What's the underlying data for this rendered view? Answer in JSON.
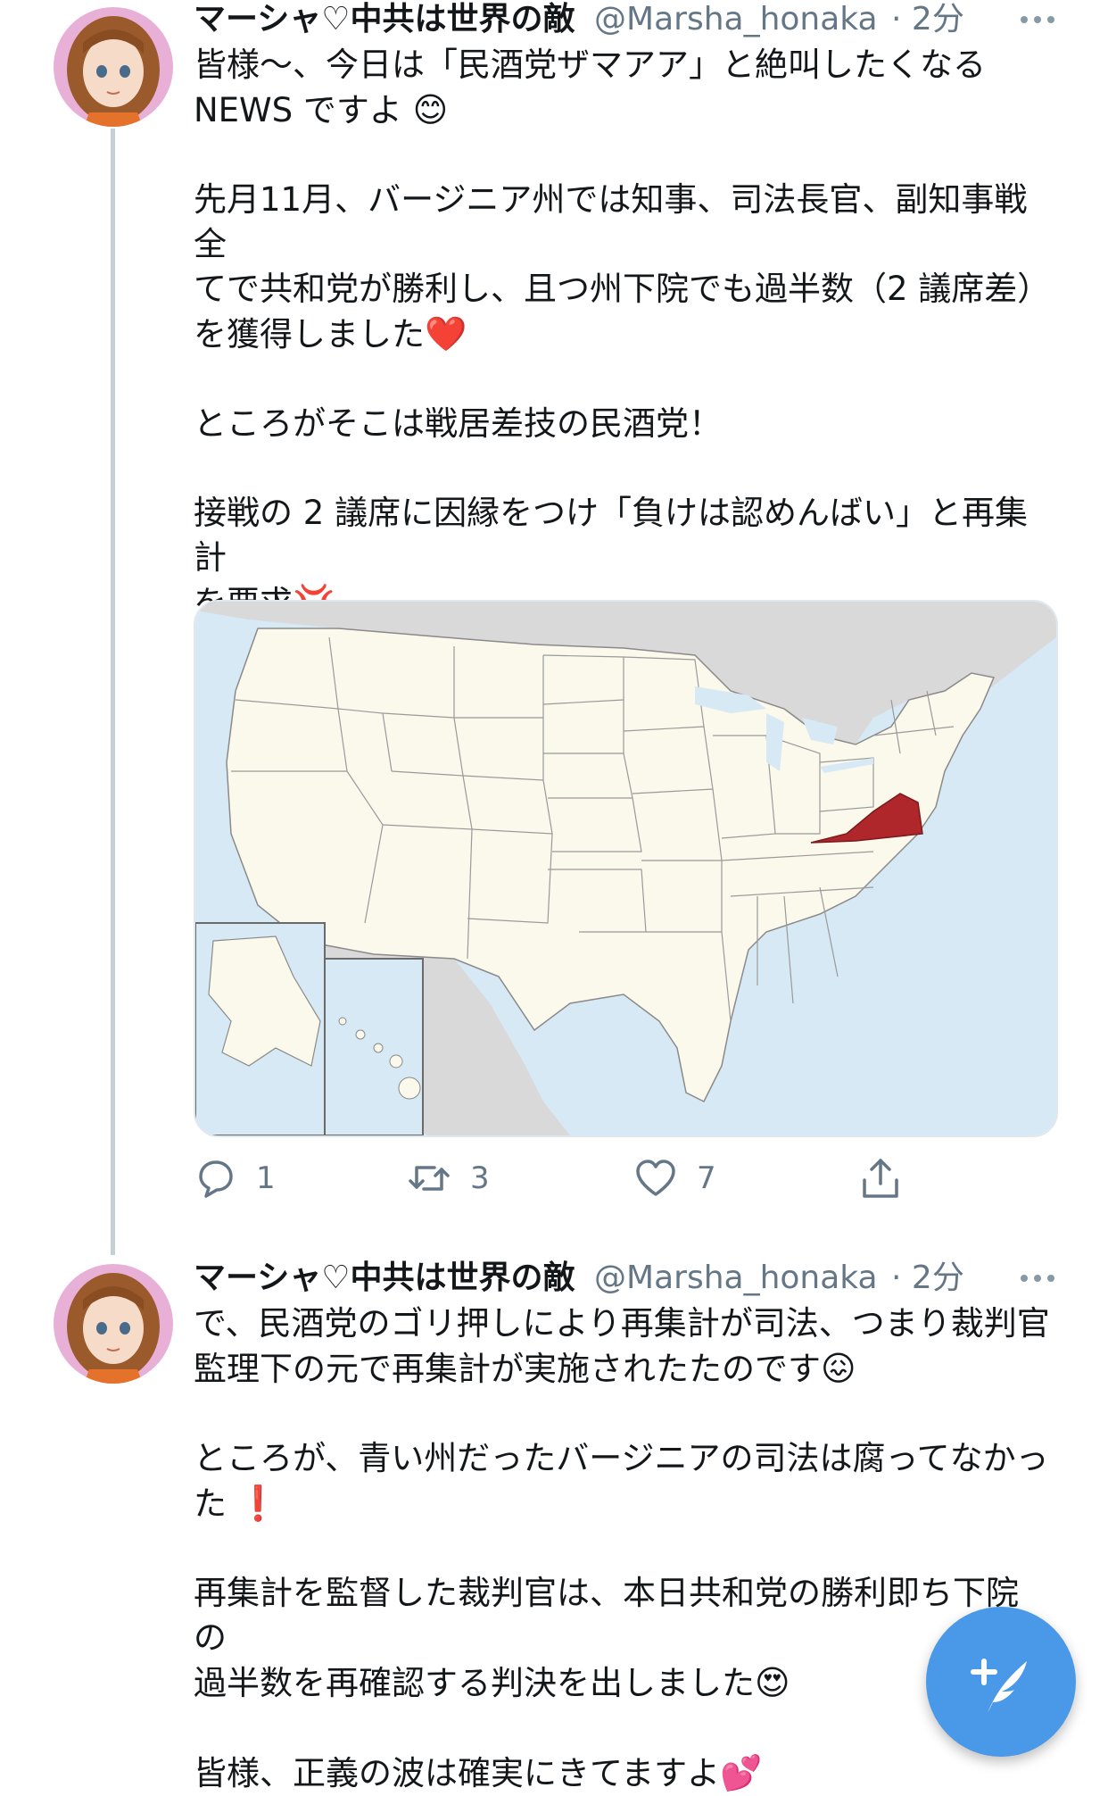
{
  "tweets": [
    {
      "name": "マーシャ♡中共は世界の敵",
      "handle": "@Marsha_honaka",
      "time": "· 2分",
      "lines": [
        "皆様〜、今日は「民酒党ザマアア」と絶叫したくなる",
        "NEWS ですよ"
      ],
      "emoji_1": "😊",
      "para2": [
        "先月11月、バージニア州では知事、司法長官、副知事戦全",
        "てで共和党が勝利し、且つ州下院でも過半数（2 議席差）",
        "を獲得しました"
      ],
      "emoji_2": "❤️",
      "para3": "ところがそこは戦居差技の民酒党！",
      "para4": [
        "接戦の 2 議席に因縁をつけ「負けは認めんばい」と再集計",
        "を要求"
      ],
      "emoji_4": "💢",
      "arrow": "↓",
      "stats": {
        "replies": "1",
        "retweets": "3",
        "likes": "7"
      }
    },
    {
      "name": "マーシャ♡中共は世界の敵",
      "handle": "@Marsha_honaka",
      "time": "· 2分",
      "para1": [
        "で、民酒党のゴリ押しにより再集計が司法、つまり裁判官",
        "監理下の元で再集計が実施されたたのです"
      ],
      "emoji_1": "😖",
      "para2": [
        "ところが、青い州だったバージニアの司法は腐ってなかっ",
        "た"
      ],
      "emoji_2": "❗",
      "para3": [
        "再集計を監督した裁判官は、本日共和党の勝利即ち下院の",
        "過半数を再確認する判決を出しました"
      ],
      "emoji_3": "😍",
      "para4": "皆様、正義の波は確実にきてますよ",
      "emoji_4": "💕"
    }
  ],
  "colors": {
    "accent": "#4a99e9",
    "highlight_state": "#b0272b",
    "land": "#fbf8ec",
    "water": "#d6e9f5"
  }
}
